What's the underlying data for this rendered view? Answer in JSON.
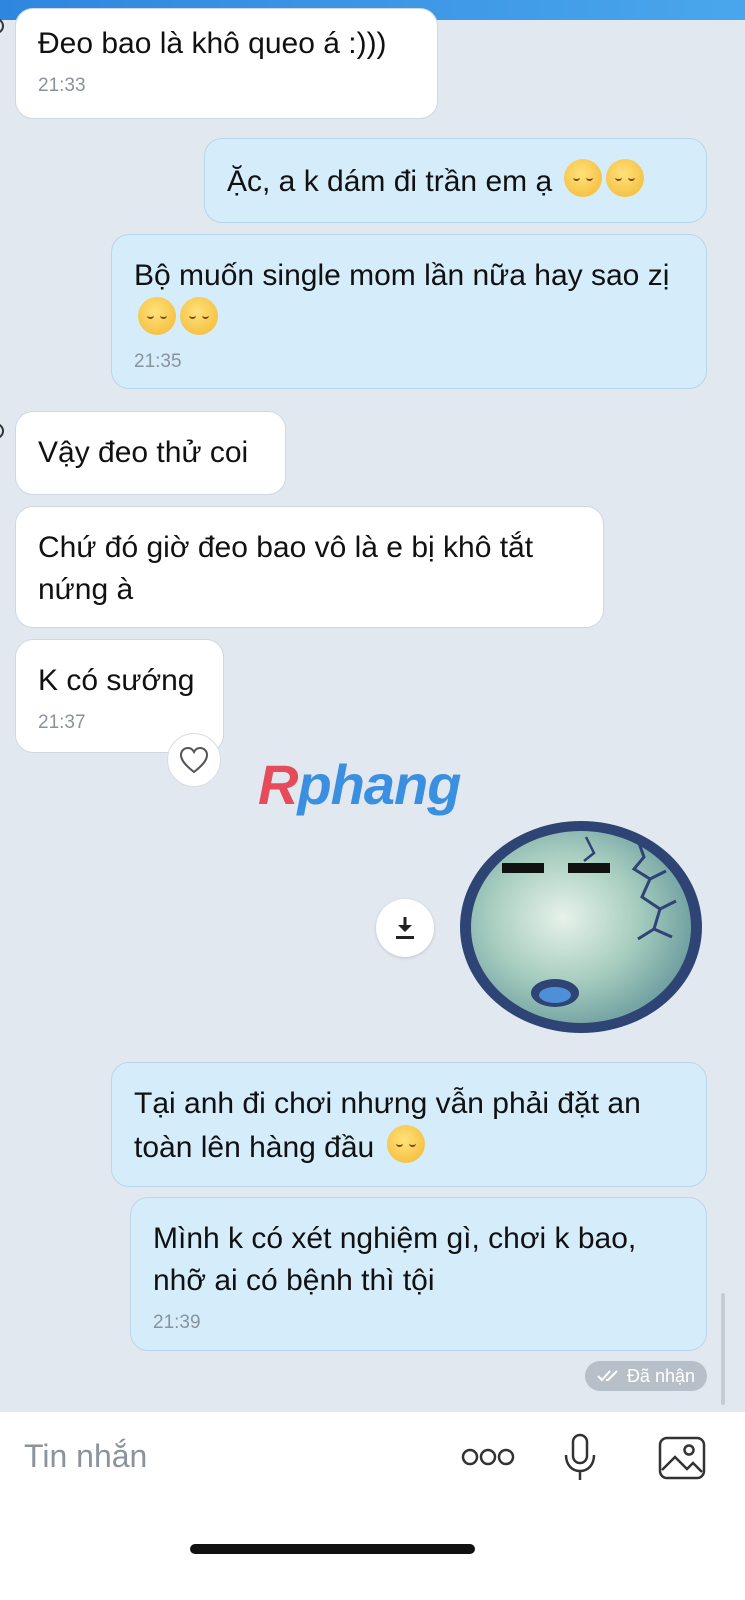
{
  "messages": [
    {
      "text": "Đeo bao là khô queo á :)))",
      "time": "21:33"
    },
    {
      "text": "Ặc, a k dám đi trần em ạ"
    },
    {
      "text": "Bộ muốn single mom lần nữa hay sao zị",
      "time": "21:35"
    },
    {
      "text": "Vậy đeo thử coi"
    },
    {
      "text": "Chứ đó giờ đeo bao vô là e bị khô tắt nứng à"
    },
    {
      "text": "K có sướng",
      "time": "21:37"
    },
    {
      "text": "Tại anh đi chơi nhưng vẫn phải đặt an toàn lên hàng đầu"
    },
    {
      "text": "Mình k có xét nghiệm gì, chơi k bao, nhỡ ai có bệnh thì tội",
      "time": "21:39"
    }
  ],
  "watermark": {
    "first": "R",
    "rest": "phang"
  },
  "status": {
    "received_label": "Đã nhận"
  },
  "composer": {
    "placeholder": "Tin nhắn"
  },
  "icons": {
    "reaction": "heart-icon",
    "download": "download-icon",
    "received": "double-check-icon",
    "more": "more-dots-icon",
    "mic": "microphone-icon",
    "image": "image-icon"
  },
  "colors": {
    "incoming_bubble": "#ffffff",
    "outgoing_bubble": "#d5ecfa",
    "background": "#e2e8ef",
    "accent": "#2f86de"
  }
}
